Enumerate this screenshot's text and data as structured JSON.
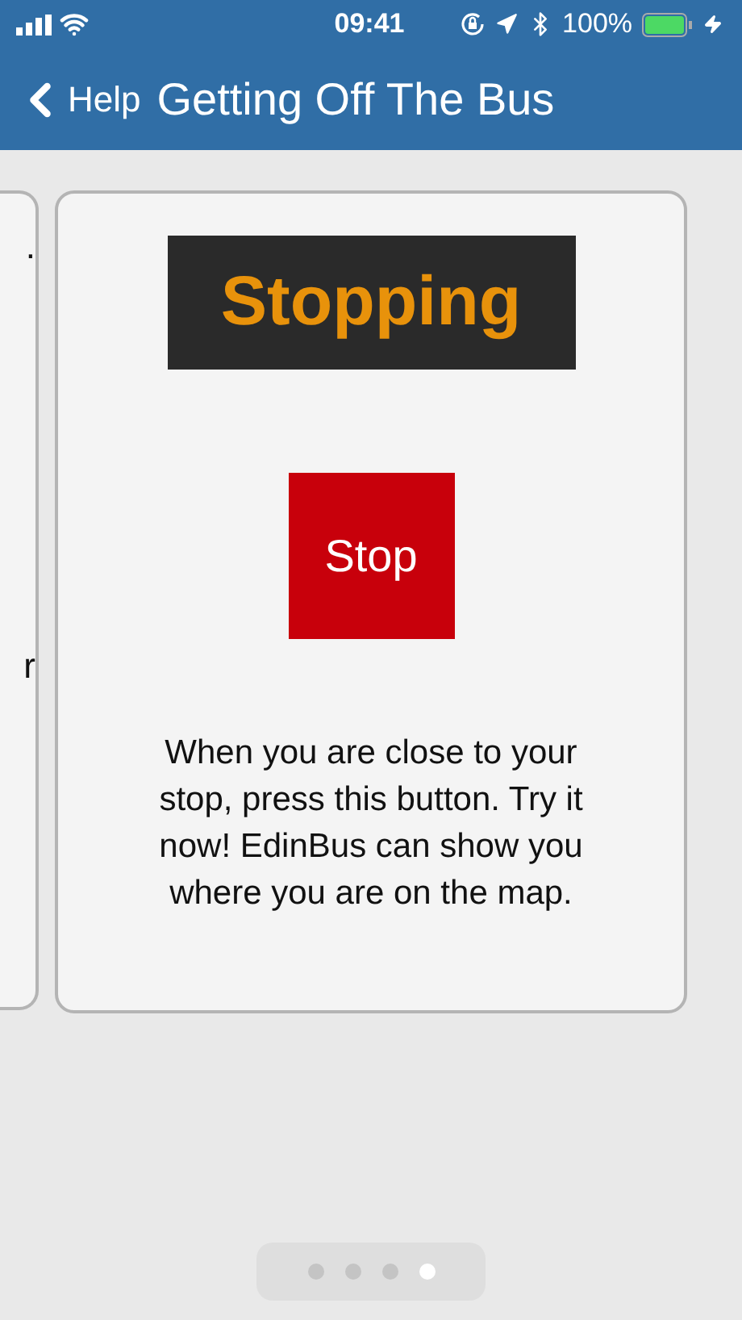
{
  "status_bar": {
    "time": "09:41",
    "battery": "100%"
  },
  "nav_bar": {
    "back_label": "Help",
    "title": "Getting Off The Bus"
  },
  "previous_card": {
    "lines": [
      ".",
      "r"
    ]
  },
  "card": {
    "banner": "Stopping",
    "button": "Stop",
    "text": "When you are close to your stop, press this button. Try it now! EdinBus can show you where you are on the map."
  },
  "pages": [
    {
      "selected": false
    },
    {
      "selected": false
    },
    {
      "selected": false
    },
    {
      "selected": true
    }
  ]
}
